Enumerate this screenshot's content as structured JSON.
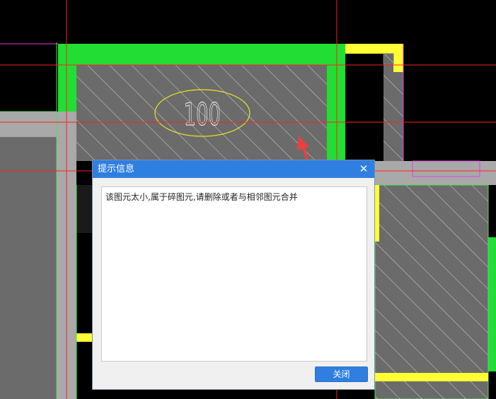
{
  "drawing": {
    "room_label": "100"
  },
  "dialog": {
    "title": "提示信息",
    "close_glyph": "✕",
    "message": "该图元太小,属于碎图元,请删除或者与相邻图元合并",
    "ok_label": "关闭"
  },
  "colors": {
    "background": "#000000",
    "wall_green": "#22dd33",
    "hatch_fill": "#6b6b6b",
    "yellow": "#ffff33",
    "magenta": "#e040e0",
    "red_grid": "#ff2020",
    "arrow": "#e84040",
    "dialog_header": "#2f7fe0"
  },
  "icons": {
    "close": "close-icon",
    "arrow": "annotation-arrow-icon"
  }
}
